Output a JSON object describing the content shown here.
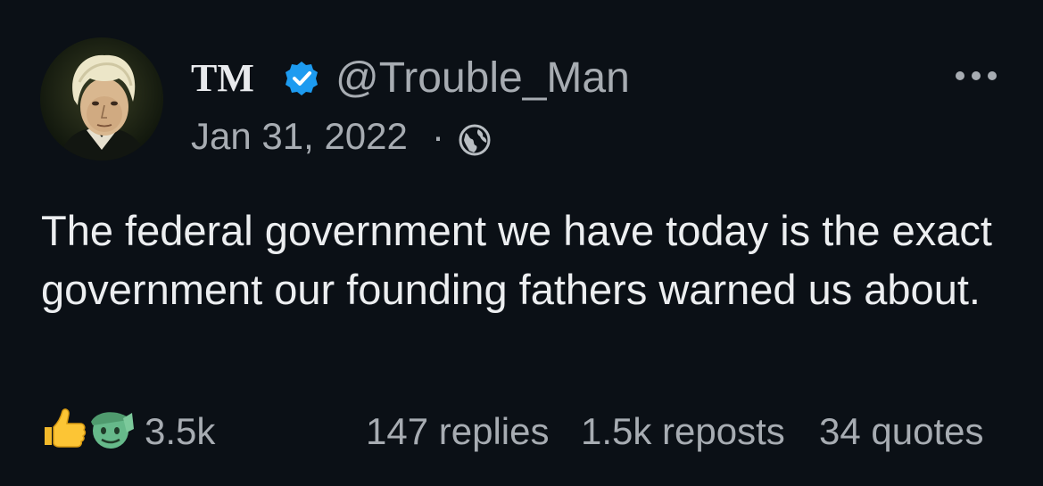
{
  "post": {
    "author": {
      "display_name": "TM",
      "handle": "@Trouble_Man",
      "verified": true,
      "avatar_icon": "portrait-avatar"
    },
    "date": "Jan 31, 2022",
    "separator": "·",
    "visibility_icon": "globe-icon",
    "text": "The federal government we have today is the exact government our founding fathers warned us about.",
    "reactions": {
      "icons": [
        "thumbs-up-icon",
        "saluting-face-icon"
      ],
      "count": "3.5k"
    },
    "stats": {
      "replies": "147 replies",
      "reposts": "1.5k reposts",
      "quotes": "34 quotes"
    }
  },
  "colors": {
    "background": "#0b1016",
    "primary_text": "#e8eaed",
    "secondary_text": "#a7acb2",
    "verified_badge": "#1d9bf0"
  }
}
